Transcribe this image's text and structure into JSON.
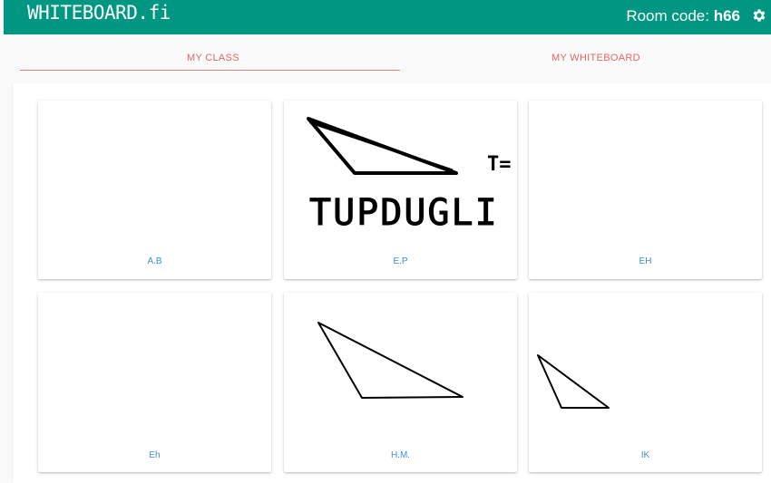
{
  "app": {
    "logo": "WHITEBOARD.fi",
    "room_code_label": "Room code: ",
    "room_code": "h66"
  },
  "tabs": [
    {
      "label": "MY CLASS",
      "active": true
    },
    {
      "label": "MY WHITEBOARD",
      "active": false
    }
  ],
  "cards": [
    {
      "label": "A.B",
      "drawing": "blank"
    },
    {
      "label": "E.P",
      "drawing": "triangle with handwritten text",
      "text_fragments": [
        "TUPDUGLI",
        "T="
      ]
    },
    {
      "label": "EH",
      "drawing": "blank"
    },
    {
      "label": "Eh",
      "drawing": "blank"
    },
    {
      "label": "H.M.",
      "drawing": "triangle"
    },
    {
      "label": "IK",
      "drawing": "triangle"
    }
  ],
  "colors": {
    "header": "#009782",
    "tab_text": "#e06767",
    "card_label": "#3d8fcf"
  },
  "icons": {
    "settings": "gear-icon"
  }
}
